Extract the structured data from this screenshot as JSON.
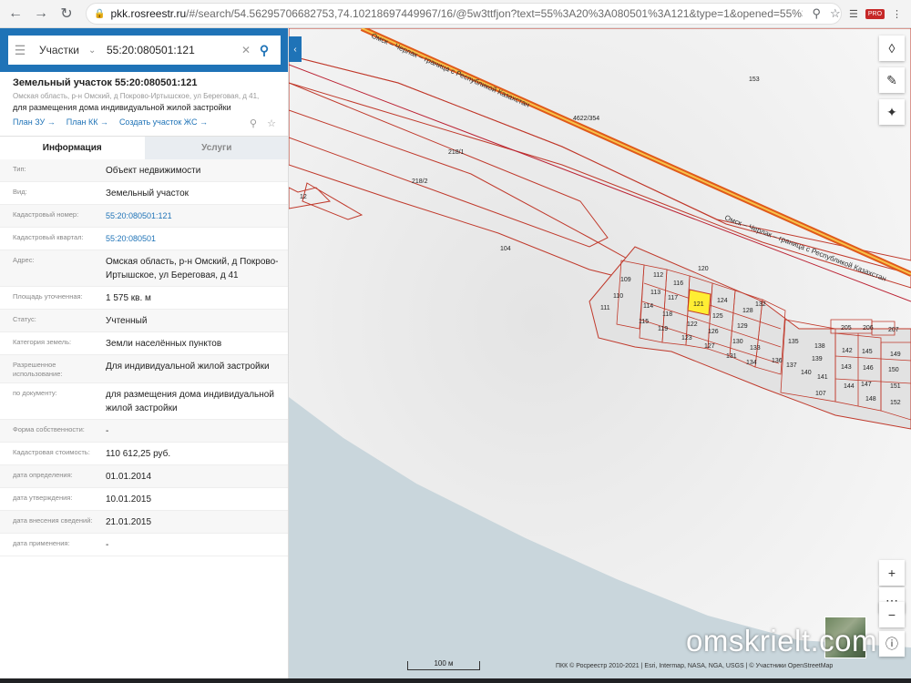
{
  "browser": {
    "url_host": "pkk.rosreestr.ru",
    "url_path": "/#/search/54.56295706682753,74.10218697449967/16/@5w3ttfjon?text=55%3A20%3A080501%3A121&type=1&opened=55%3A20%3A08..."
  },
  "search": {
    "type": "Участки",
    "value": "55:20:080501:121"
  },
  "object": {
    "title": "Земельный участок 55:20:080501:121",
    "address": "Омская область, р-н Омский, д Покрово-Иртышское, ул Береговая, д 41,",
    "purpose": "для размещения дома индивидуальной жилой застройки",
    "links": [
      "План ЗУ →",
      "План КК →",
      "Создать участок ЖС →"
    ]
  },
  "tabs": [
    "Информация",
    "Услуги"
  ],
  "rows": [
    {
      "label": "Тип:",
      "value": "Объект недвижимости"
    },
    {
      "label": "Вид:",
      "value": "Земельный участок"
    },
    {
      "label": "Кадастровый номер:",
      "value": "55:20:080501:121"
    },
    {
      "label": "Кадастровый квартал:",
      "value": "55:20:080501"
    },
    {
      "label": "Адрес:",
      "value": "Омская область, р-н Омский, д Покрово-Иртышское, ул Береговая, д 41"
    },
    {
      "label": "Площадь уточненная:",
      "value": "1 575 кв. м"
    },
    {
      "label": "Статус:",
      "value": "Учтенный"
    },
    {
      "label": "Категория земель:",
      "value": "Земли населённых пунктов"
    },
    {
      "label": "Разрешенное использование:",
      "value": "Для индивидуальной жилой застройки"
    },
    {
      "label": "по документу:",
      "value": "для размещения дома индивидуальной жилой застройки"
    },
    {
      "label": "Форма собственности:",
      "value": "-"
    },
    {
      "label": "Кадастровая стоимость:",
      "value": "110 612,25 руб."
    },
    {
      "label": "дата определения:",
      "value": "01.01.2014"
    },
    {
      "label": "дата утверждения:",
      "value": "10.01.2015"
    },
    {
      "label": "дата внесения сведений:",
      "value": "21.01.2015"
    },
    {
      "label": "дата применения:",
      "value": "-"
    }
  ],
  "map": {
    "parcel_labels": [
      "153",
      "4622/354",
      "218/1",
      "218/2",
      "12",
      "104",
      "109",
      "110",
      "111",
      "112",
      "113",
      "114",
      "115",
      "116",
      "117",
      "118",
      "119",
      "120",
      "121",
      "122",
      "123",
      "124",
      "125",
      "126",
      "127",
      "128",
      "129",
      "130",
      "131",
      "132",
      "133",
      "134",
      "135",
      "136",
      "137",
      "138",
      "139",
      "140",
      "141",
      "142",
      "143",
      "144",
      "145",
      "146",
      "147",
      "148",
      "149",
      "150",
      "151",
      "152",
      "205",
      "206",
      "207",
      "107"
    ],
    "road_label_1": "Омск – Черлак – граница с Республикой Казахстан",
    "road_label_2": "Омск – Черлак – граница с Республикой Казахстан",
    "scale": "100 м",
    "attribution": "ПКК © Росреестр 2010-2021 | Esri, Intermap, NASA, NGA, USGS | © Участники OpenStreetMap",
    "watermark": "omskrielt.com",
    "selected_parcel": "121",
    "colors": {
      "selected": "#ffee33",
      "boundary": "#c0392b",
      "water": "#c9d6dc"
    }
  }
}
